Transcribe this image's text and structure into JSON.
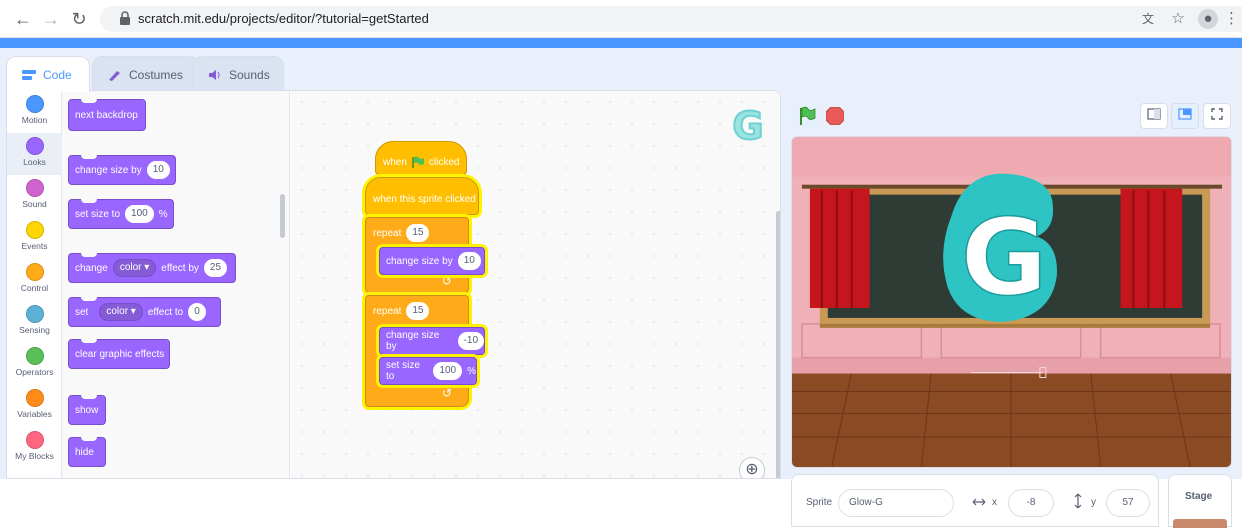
{
  "browser": {
    "url": "scratch.mit.edu/projects/editor/?tutorial=getStarted"
  },
  "tabs": {
    "code": "Code",
    "costumes": "Costumes",
    "sounds": "Sounds"
  },
  "categories": [
    {
      "label": "Motion",
      "color": "#4c97ff"
    },
    {
      "label": "Looks",
      "color": "#9966ff"
    },
    {
      "label": "Sound",
      "color": "#cf63cf"
    },
    {
      "label": "Events",
      "color": "#ffd500"
    },
    {
      "label": "Control",
      "color": "#ffab19"
    },
    {
      "label": "Sensing",
      "color": "#5cb1d6"
    },
    {
      "label": "Operators",
      "color": "#59c059"
    },
    {
      "label": "Variables",
      "color": "#ff8c1a"
    },
    {
      "label": "My Blocks",
      "color": "#ff6680"
    }
  ],
  "palette": {
    "next_backdrop": "next backdrop",
    "change_size_by": "change size by",
    "change_size_value": "10",
    "set_size_to": "set size to",
    "set_size_value": "100",
    "percent": "%",
    "change": "change",
    "effect_by": "effect by",
    "color_dd": "color ▾",
    "effect_value": "25",
    "set": "set",
    "effect_to": "effect to",
    "effect_to_value": "0",
    "clear_graphic_effects": "clear graphic effects",
    "show": "show",
    "hide": "hide"
  },
  "script": {
    "when": "when",
    "clicked": "clicked",
    "when_sprite_clicked": "when this sprite clicked",
    "repeat": "repeat",
    "repeat1_count": "15",
    "change_size_by": "change size by",
    "change1_value": "10",
    "repeat2_count": "15",
    "change2_value": "-10",
    "set_size_to": "set size to",
    "set_value": "100",
    "percent": "%",
    "loop_arrow": "↺"
  },
  "sprite_thumb_letter": "G",
  "stage": {
    "sprite_letter": "G"
  },
  "sprite_info": {
    "sprite_label": "Sprite",
    "sprite_name": "Glow-G",
    "x_label": "x",
    "x_value": "-8",
    "y_label": "y",
    "y_value": "57",
    "stage_label": "Stage"
  },
  "colors": {
    "accent": "#4c97ff",
    "looks": "#9966ff",
    "control": "#ffab19",
    "events": "#ffbf00",
    "glow": "#fff200",
    "sprite_teal": "#2ec4c4"
  }
}
